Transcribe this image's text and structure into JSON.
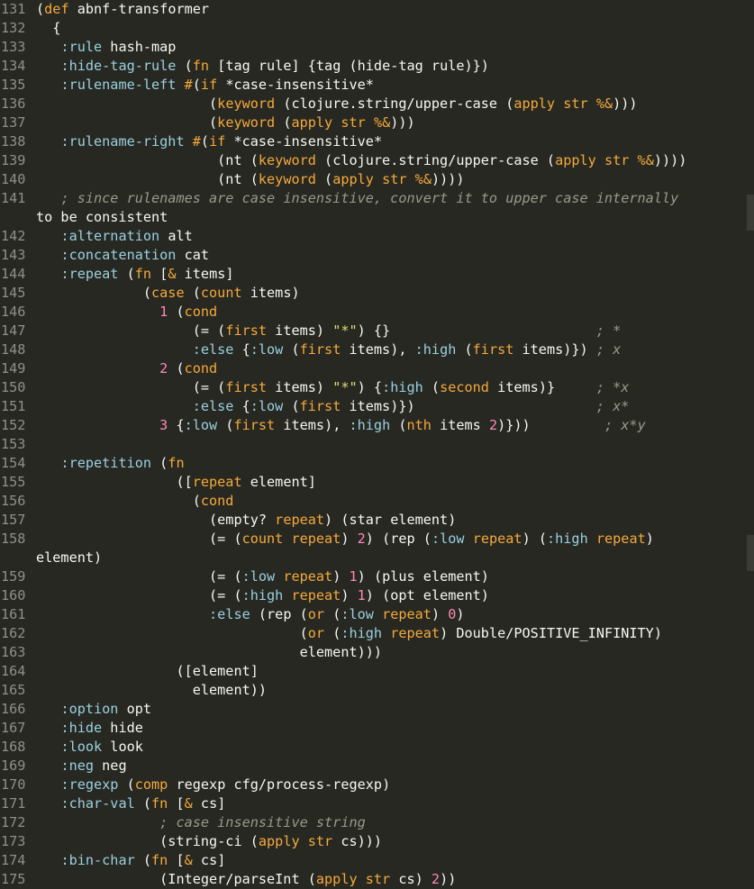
{
  "editor": {
    "lines": [
      {
        "n": "131",
        "t": "(def abnf-transformer"
      },
      {
        "n": "132",
        "t": "  {"
      },
      {
        "n": "133",
        "t": "   :rule hash-map"
      },
      {
        "n": "134",
        "t": "   :hide-tag-rule (fn [tag rule] {tag (hide-tag rule)})"
      },
      {
        "n": "135",
        "t": "   :rulename-left #(if *case-insensitive*"
      },
      {
        "n": "136",
        "t": "                     (keyword (clojure.string/upper-case (apply str %&)))"
      },
      {
        "n": "137",
        "t": "                     (keyword (apply str %&)))"
      },
      {
        "n": "138",
        "t": "   :rulename-right #(if *case-insensitive*"
      },
      {
        "n": "139",
        "t": "                      (nt (keyword (clojure.string/upper-case (apply str %&))))"
      },
      {
        "n": "140",
        "t": "                      (nt (keyword (apply str %&))))"
      },
      {
        "n": "141",
        "t": "   ; since rulenames are case insensitive, convert it to upper case internally"
      },
      {
        "n": "",
        "t": "to be consistent"
      },
      {
        "n": "142",
        "t": "   :alternation alt"
      },
      {
        "n": "143",
        "t": "   :concatenation cat"
      },
      {
        "n": "144",
        "t": "   :repeat (fn [& items]"
      },
      {
        "n": "145",
        "t": "             (case (count items)"
      },
      {
        "n": "146",
        "t": "               1 (cond"
      },
      {
        "n": "147",
        "t": "                   (= (first items) \"*\") {}                         ; *"
      },
      {
        "n": "148",
        "t": "                   :else {:low (first items), :high (first items)}) ; x"
      },
      {
        "n": "149",
        "t": "               2 (cond"
      },
      {
        "n": "150",
        "t": "                   (= (first items) \"*\") {:high (second items)}     ; *x"
      },
      {
        "n": "151",
        "t": "                   :else {:low (first items)})                      ; x*"
      },
      {
        "n": "152",
        "t": "               3 {:low (first items), :high (nth items 2)}))         ; x*y"
      },
      {
        "n": "153",
        "t": ""
      },
      {
        "n": "154",
        "t": "   :repetition (fn"
      },
      {
        "n": "155",
        "t": "                 ([repeat element]"
      },
      {
        "n": "156",
        "t": "                   (cond"
      },
      {
        "n": "157",
        "t": "                     (empty? repeat) (star element)"
      },
      {
        "n": "158",
        "t": "                     (= (count repeat) 2) (rep (:low repeat) (:high repeat)"
      },
      {
        "n": "",
        "t": "element)"
      },
      {
        "n": "159",
        "t": "                     (= (:low repeat) 1) (plus element)"
      },
      {
        "n": "160",
        "t": "                     (= (:high repeat) 1) (opt element)"
      },
      {
        "n": "161",
        "t": "                     :else (rep (or (:low repeat) 0)"
      },
      {
        "n": "162",
        "t": "                                (or (:high repeat) Double/POSITIVE_INFINITY)"
      },
      {
        "n": "163",
        "t": "                                element)))"
      },
      {
        "n": "164",
        "t": "                 ([element]"
      },
      {
        "n": "165",
        "t": "                   element))"
      },
      {
        "n": "166",
        "t": "   :option opt"
      },
      {
        "n": "167",
        "t": "   :hide hide"
      },
      {
        "n": "168",
        "t": "   :look look"
      },
      {
        "n": "169",
        "t": "   :neg neg"
      },
      {
        "n": "170",
        "t": "   :regexp (comp regexp cfg/process-regexp)"
      },
      {
        "n": "171",
        "t": "   :char-val (fn [& cs]"
      },
      {
        "n": "172",
        "t": "               ; case insensitive string"
      },
      {
        "n": "173",
        "t": "               (string-ci (apply str cs)))"
      },
      {
        "n": "174",
        "t": "   :bin-char (fn [& cs]"
      },
      {
        "n": "175",
        "t": "               (Integer/parseInt (apply str cs) 2))"
      }
    ]
  },
  "colors": {
    "background": "#272822",
    "gutter_text": "#8f908a",
    "foreground": "#f8f8f2",
    "keyword": "#f6a93b",
    "keyword_symbol": "#9bd0e0",
    "string": "#e6db74",
    "number": "#ff88b8",
    "comment": "#9a9a8a"
  }
}
